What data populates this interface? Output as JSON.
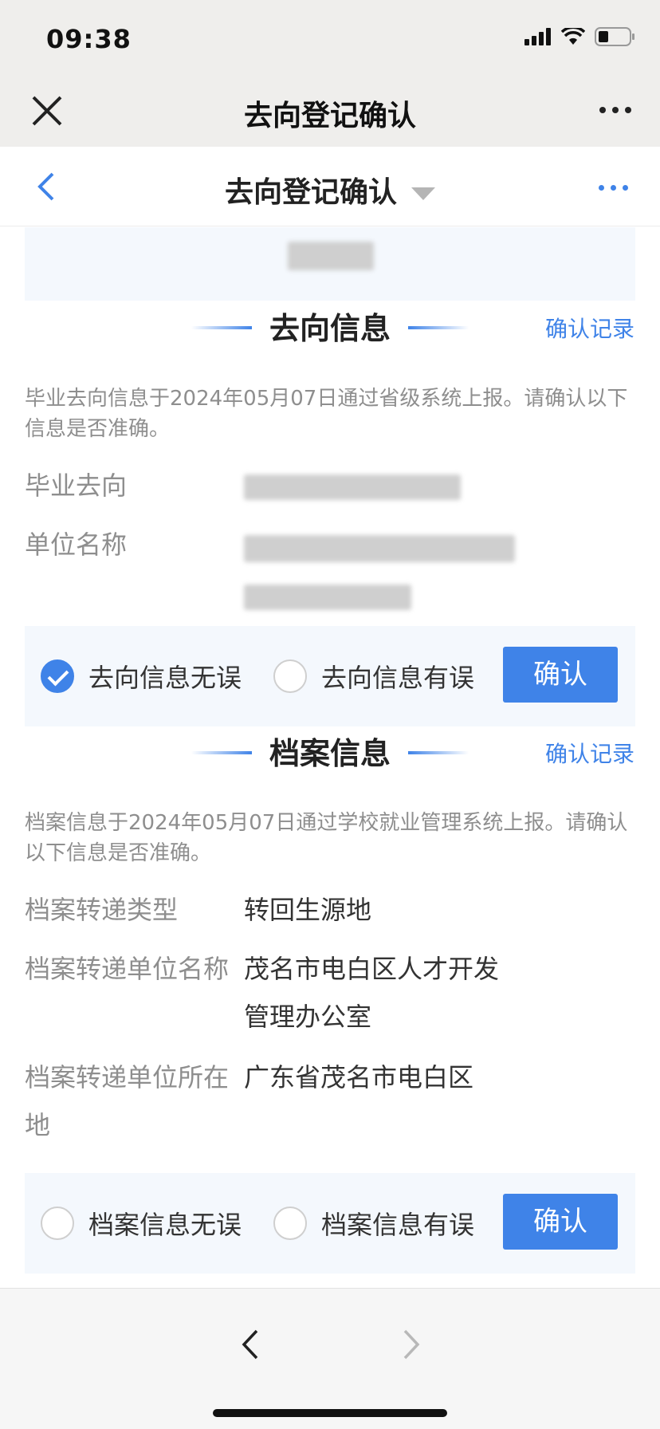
{
  "status_bar": {
    "time": "09:38"
  },
  "webview": {
    "title": "去向登记确认"
  },
  "navbar": {
    "title": "去向登记确认"
  },
  "destination_section": {
    "title": "去向信息",
    "record_link": "确认记录",
    "description": "毕业去向信息于2024年05月07日通过省级系统上报。请确认以下信息是否准确。",
    "fields": [
      {
        "label": "毕业去向",
        "value": ""
      },
      {
        "label": "单位名称",
        "value": ""
      }
    ],
    "option_correct": "去向信息无误",
    "option_wrong": "去向信息有误",
    "selected": "correct",
    "confirm_label": "确认"
  },
  "archive_section": {
    "title": "档案信息",
    "record_link": "确认记录",
    "description": "档案信息于2024年05月07日通过学校就业管理系统上报。请确认以下信息是否准确。",
    "fields": [
      {
        "label": "档案转递类型",
        "value": "转回生源地"
      },
      {
        "label": "档案转递单位名称",
        "value": "茂名市电白区人才开发管理办公室"
      },
      {
        "label": "档案转递单位所在地",
        "value": "广东省茂名市电白区"
      }
    ],
    "option_correct": "档案信息无误",
    "option_wrong": "档案信息有误",
    "selected": "none",
    "confirm_label": "确认"
  },
  "colors": {
    "accent": "#3f83e8",
    "panel": "#f4f8fd"
  }
}
